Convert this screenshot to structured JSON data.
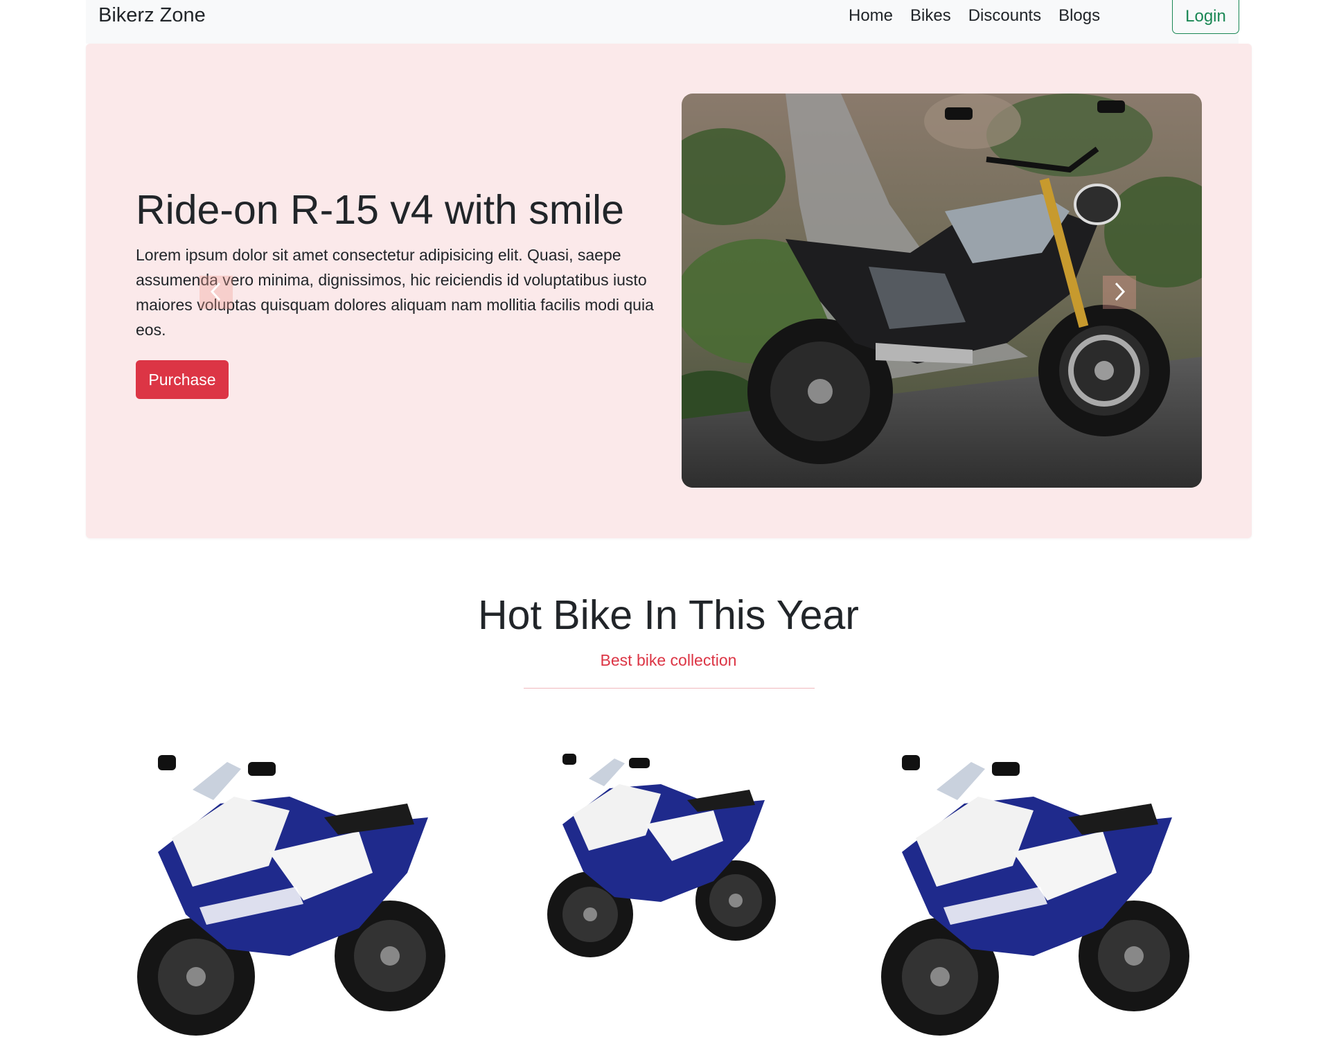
{
  "navbar": {
    "brand": "Bikerz Zone",
    "links": [
      "Home",
      "Bikes",
      "Discounts",
      "Blogs"
    ],
    "login_label": "Login"
  },
  "hero": {
    "title": "Ride-on R-15 v4 with smile",
    "text": "Lorem ipsum dolor sit amet consectetur adipisicing elit. Quasi, saepe assumenda vero minima, dignissimos, hic reiciendis id voluptatibus iusto maiores voluptas quisquam dolores aliquam nam mollitia facilis modi quia eos.",
    "button_label": "Purchase",
    "prev_icon": "chevron-left-icon",
    "next_icon": "chevron-right-icon"
  },
  "section": {
    "title": "Hot Bike In This Year",
    "subtitle": "Best bike collection"
  },
  "colors": {
    "accent_red": "#dc3545",
    "success_green": "#198754",
    "hero_bg": "#fbe9ea",
    "navbar_bg": "#f8f9fa"
  }
}
